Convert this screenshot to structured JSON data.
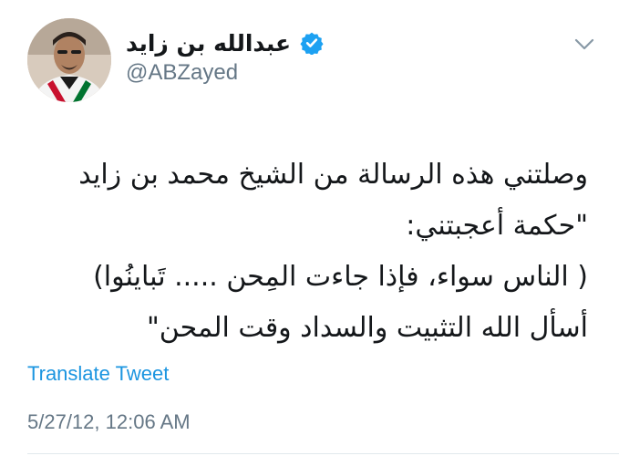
{
  "tweet": {
    "author": {
      "display_name": "عبدالله بن زايد",
      "handle": "@ABZayed",
      "verified_icon": "verified-badge-icon",
      "avatar_icon": "profile-photo"
    },
    "menu_icon": "chevron-down-icon",
    "text_lines": [
      "وصلتني هذه الرسالة من الشيخ محمد بن زايد",
      "\"حكمة أعجبتني:",
      "( الناس سواء، فإذا جاءت المِحن ..... تَباينُوا)",
      "أسأل الله التثبيت والسداد وقت المحن\""
    ],
    "translate_label": "Translate Tweet",
    "timestamp": "5/27/12, 12:06 AM"
  },
  "colors": {
    "text": "#14171a",
    "secondary": "#657786",
    "link": "#1b95e0",
    "verified": "#1da1f2",
    "divider": "#e1e8ed"
  }
}
